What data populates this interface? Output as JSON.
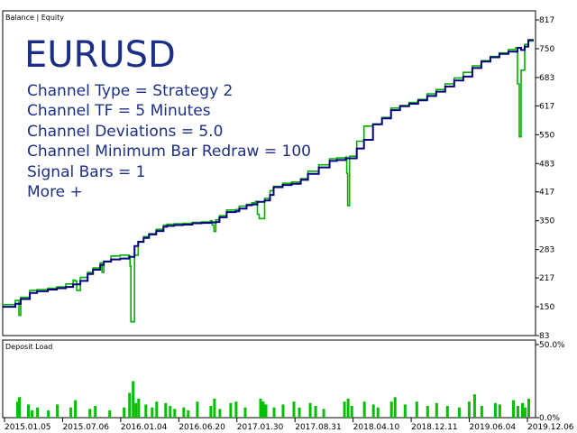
{
  "legend": {
    "balance": "Balance",
    "separator": " | ",
    "equity": "Equity"
  },
  "overlay": {
    "symbol": "EURUSD",
    "lines": [
      "Channel Type = Strategy 2",
      "Channel TF = 5 Minutes",
      "Channel Deviations = 5.0",
      "Channel Minimum Bar Redraw = 100",
      "Signal Bars = 1",
      "More +"
    ]
  },
  "deposit_panel": {
    "title": "Deposit Load"
  },
  "colors": {
    "balance": "#000080",
    "equity": "#00b000",
    "deposit_load": "#00c000",
    "axis": "#000000",
    "background": "#ffffff"
  },
  "chart_data": [
    {
      "type": "line",
      "title": "",
      "series": [
        {
          "name": "Balance",
          "x": [
            0,
            14,
            20,
            30,
            38,
            50,
            60,
            70,
            78,
            86,
            94,
            100,
            108,
            112,
            120,
            130,
            140,
            146,
            150,
            156,
            162,
            170,
            178,
            182,
            190,
            200,
            210,
            220,
            230,
            236,
            240,
            248,
            258,
            262,
            270,
            276,
            282,
            290,
            296,
            300,
            310,
            320,
            330,
            338,
            350,
            362,
            370,
            380,
            392,
            400,
            410,
            420,
            430,
            440,
            450,
            460,
            470,
            480,
            490,
            500,
            510,
            520,
            530,
            540,
            550,
            560,
            570,
            574,
            578,
            582,
            588
          ],
          "values": [
            150,
            157,
            168,
            182,
            186,
            190,
            193,
            196,
            202,
            210,
            226,
            236,
            247,
            255,
            260,
            262,
            266,
            291,
            301,
            310,
            318,
            326,
            336,
            338,
            340,
            341,
            344,
            345,
            346,
            347,
            358,
            370,
            372,
            378,
            386,
            388,
            394,
            397,
            410,
            428,
            433,
            436,
            445,
            459,
            474,
            489,
            491,
            495,
            518,
            538,
            574,
            588,
            607,
            616,
            622,
            630,
            640,
            650,
            662,
            676,
            685,
            705,
            720,
            730,
            738,
            743,
            752,
            747,
            755,
            770,
            770
          ]
        },
        {
          "name": "Equity",
          "x": [
            0,
            14,
            18,
            20,
            30,
            38,
            50,
            60,
            70,
            78,
            80,
            82,
            86,
            94,
            100,
            108,
            110,
            112,
            120,
            130,
            140,
            141,
            142,
            146,
            150,
            156,
            162,
            170,
            178,
            182,
            190,
            200,
            210,
            220,
            230,
            232,
            234,
            236,
            240,
            248,
            258,
            262,
            270,
            276,
            280,
            282,
            284,
            290,
            296,
            300,
            310,
            320,
            330,
            338,
            350,
            362,
            370,
            380,
            381,
            382,
            384,
            392,
            400,
            410,
            420,
            430,
            440,
            450,
            460,
            470,
            480,
            490,
            500,
            510,
            520,
            530,
            540,
            550,
            560,
            568,
            570,
            572,
            574,
            578,
            582,
            588
          ],
          "values": [
            155,
            165,
            130,
            172,
            188,
            190,
            193,
            196,
            203,
            212,
            210,
            188,
            218,
            230,
            240,
            252,
            230,
            256,
            268,
            270,
            268,
            245,
            115,
            270,
            300,
            313,
            320,
            330,
            340,
            342,
            343,
            344,
            346,
            347,
            350,
            340,
            325,
            352,
            362,
            375,
            376,
            384,
            388,
            392,
            395,
            365,
            355,
            402,
            420,
            430,
            437,
            440,
            448,
            465,
            480,
            494,
            496,
            498,
            460,
            385,
            500,
            535,
            570,
            575,
            590,
            612,
            618,
            625,
            632,
            645,
            655,
            668,
            682,
            695,
            710,
            722,
            732,
            740,
            748,
            752,
            668,
            545,
            700,
            760,
            768,
            768
          ]
        }
      ],
      "xlabel": "",
      "ylabel": "",
      "xlim": [
        0,
        590
      ],
      "ylim": [
        83,
        817
      ],
      "y_ticks": [
        "817",
        "750",
        "683",
        "617",
        "550",
        "483",
        "417",
        "350",
        "283",
        "217",
        "150",
        "83"
      ],
      "x_ticks": [
        "2015.01.05",
        "2015.07.06",
        "2016.01.04",
        "2016.06.20",
        "2017.01.30",
        "2017.08.31",
        "2018.04.10",
        "2018.12.11",
        "2019.06.04",
        "2019.12.06"
      ],
      "legend_position": "top-left",
      "grid": false
    },
    {
      "type": "bar",
      "title": "Deposit Load",
      "series": [
        {
          "name": "Deposit Load",
          "x": [
            16,
            18,
            28,
            32,
            38,
            50,
            60,
            75,
            80,
            96,
            102,
            118,
            134,
            140,
            144,
            147,
            150,
            158,
            165,
            170,
            180,
            185,
            190,
            200,
            205,
            215,
            230,
            234,
            240,
            252,
            258,
            268,
            285,
            288,
            291,
            300,
            310,
            322,
            328,
            340,
            346,
            355,
            378,
            382,
            386,
            400,
            410,
            415,
            430,
            434,
            445,
            458,
            470,
            480,
            492,
            505,
            516,
            522,
            530,
            545,
            550,
            565,
            570,
            575,
            578,
            582
          ],
          "values": [
            11,
            14,
            9,
            5,
            7,
            5,
            9,
            7,
            12,
            6,
            8,
            5,
            7,
            17,
            25,
            10,
            13,
            9,
            7,
            11,
            10,
            8,
            6,
            7,
            5,
            11,
            8,
            13,
            6,
            10,
            11,
            7,
            13,
            11,
            9,
            7,
            9,
            11,
            7,
            10,
            8,
            6,
            11,
            13,
            8,
            11,
            9,
            7,
            11,
            14,
            9,
            11,
            8,
            10,
            8,
            7,
            11,
            16,
            8,
            10,
            9,
            12,
            8,
            10,
            7,
            13
          ]
        }
      ],
      "ylim": [
        0,
        50
      ],
      "y_ticks": [
        "50.0%",
        "0.0%"
      ],
      "legend_position": "none",
      "grid": false
    }
  ]
}
